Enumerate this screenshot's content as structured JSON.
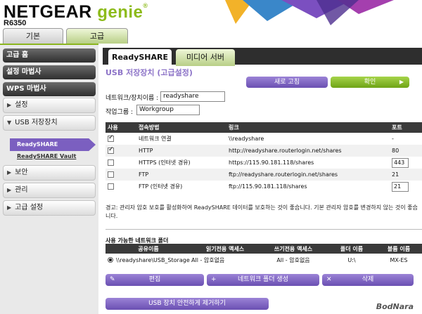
{
  "header": {
    "brand": "NETGEAR",
    "product": "genie",
    "reg": "®",
    "model": "R6350"
  },
  "main_tabs": [
    {
      "label": "기본"
    },
    {
      "label": "고급"
    }
  ],
  "sidebar": {
    "dark_items": [
      {
        "label": "고급 홈"
      },
      {
        "label": "설정 마법사"
      },
      {
        "label": "WPS 마법사"
      }
    ],
    "items": [
      {
        "label": "설정"
      },
      {
        "label": "USB 저장장치"
      },
      {
        "label": "보안"
      },
      {
        "label": "관리"
      },
      {
        "label": "고급 설정"
      }
    ],
    "sub_items": [
      {
        "label": "ReadySHARE"
      },
      {
        "label": "ReadySHARE Vault"
      }
    ],
    "arrow": "▶",
    "arrow_open": "▼"
  },
  "sub_tabs": [
    {
      "label": "ReadySHARE"
    },
    {
      "label": "미디어 서버"
    }
  ],
  "page_title": "USB 저장장치 (고급설정)",
  "buttons": {
    "refresh": "새로 고침",
    "apply": "확인",
    "apply_arrow": "▶"
  },
  "form": {
    "network_name_label": "네트워크/장치이름 :",
    "network_name_value": "readyshare",
    "workgroup_label": "작업그룹 :",
    "workgroup_value": "Workgroup"
  },
  "access_table": {
    "headers": [
      "사용",
      "접속방법",
      "링크",
      "포트"
    ],
    "rows": [
      {
        "checked": true,
        "method": "네트워크 연결",
        "link": "\\\\readyshare",
        "port": "-",
        "port_input": false
      },
      {
        "checked": true,
        "method": "HTTP",
        "link": "http://readyshare.routerlogin.net/shares",
        "port": "80",
        "port_input": false
      },
      {
        "checked": false,
        "method": "HTTPS (인터넷 경유)",
        "link": "https://115.90.181.118/shares",
        "port": "443",
        "port_input": true
      },
      {
        "checked": false,
        "method": "FTP",
        "link": "ftp://readyshare.routerlogin.net/shares",
        "port": "21",
        "port_input": false
      },
      {
        "checked": false,
        "method": "FTP (인터넷 경유)",
        "link": "ftp://115.90.181.118/shares",
        "port": "21",
        "port_input": true
      }
    ]
  },
  "warning": "경고: 관리자 암호 보호를 활성화하여 ReadySHARE 데이터를 보호하는 것이 좋습니다. 기본 관리자 암호를 변경하지 않는 것이 좋습니다.",
  "folders": {
    "label": "사용 가능한 네트워크 폴더",
    "headers": [
      "공유이름",
      "읽기전용 액세스",
      "쓰기전용 액세스",
      "폴더 이름",
      "볼륨 이름"
    ],
    "rows": [
      {
        "share": "\\\\readyshare\\USB_Storage",
        "read": "All - 암호없음",
        "write": "All - 암호없음",
        "folder": "U:\\",
        "volume": "MX-ES"
      }
    ]
  },
  "folder_buttons": {
    "edit": "편집",
    "create": "네트워크 폴더 생성",
    "delete": "삭제",
    "edit_icon": "✎",
    "create_icon": "+",
    "delete_icon": "✕"
  },
  "eject_button": "USB 장치 안전하게 제거하기",
  "watermark": "BodNara",
  "colors": {
    "accent_green": "#8dbb1b",
    "purple": "#7b5fc0",
    "dark_bar": "#2e2e2e"
  }
}
